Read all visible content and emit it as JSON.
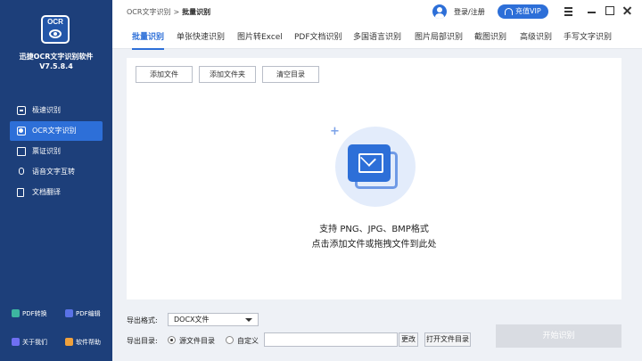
{
  "app": {
    "logo_text": "OCR",
    "name": "迅捷OCR文字识别软件",
    "version": "V7.5.8.4"
  },
  "sidebar": {
    "items": [
      {
        "label": "极速识别",
        "icon": "fast-scan-icon",
        "active": false
      },
      {
        "label": "OCR文字识别",
        "icon": "ocr-scan-icon",
        "active": true
      },
      {
        "label": "票证识别",
        "icon": "ticket-icon",
        "active": false
      },
      {
        "label": "语音文字互转",
        "icon": "microphone-icon",
        "active": false
      },
      {
        "label": "文档翻译",
        "icon": "document-icon",
        "active": false
      }
    ],
    "tools": [
      {
        "label": "PDF转换",
        "color": "#3db6a0"
      },
      {
        "label": "PDF编辑",
        "color": "#5a72e6"
      },
      {
        "label": "关于我们",
        "color": "#6f6ff2"
      },
      {
        "label": "软件帮助",
        "color": "#f0a13c"
      }
    ]
  },
  "titlebar": {
    "breadcrumb_parent": "OCR文字识别",
    "breadcrumb_sep": ">",
    "breadcrumb_current": "批量识别",
    "login_label": "登录/注册",
    "vip_label": "充值VIP"
  },
  "tabs": [
    {
      "label": "批量识别",
      "active": true
    },
    {
      "label": "单张快速识别",
      "active": false
    },
    {
      "label": "图片转Excel",
      "active": false
    },
    {
      "label": "PDF文档识别",
      "active": false
    },
    {
      "label": "多国语言识别",
      "active": false
    },
    {
      "label": "图片局部识别",
      "active": false
    },
    {
      "label": "截图识别",
      "active": false
    },
    {
      "label": "高级识别",
      "active": false
    },
    {
      "label": "手写文字识别",
      "active": false
    }
  ],
  "toolbar": {
    "add_file": "添加文件",
    "add_folder": "添加文件夹",
    "clear_list": "清空目录"
  },
  "dropzone": {
    "line1": "支持 PNG、JPG、BMP格式",
    "line2": "点击添加文件或拖拽文件到此处",
    "plus": "+"
  },
  "export": {
    "format_label": "导出格式:",
    "format_value": "DOCX文件",
    "dir_label": "导出目录:",
    "option_source": "源文件目录",
    "option_custom": "自定义",
    "change_button": "更改",
    "open_dir_button": "打开文件目录",
    "start_button": "开始识别"
  },
  "colors": {
    "sidebar_bg": "#1d3f7a",
    "accent": "#2d6fd8",
    "start_disabled": "#d9dce2"
  }
}
